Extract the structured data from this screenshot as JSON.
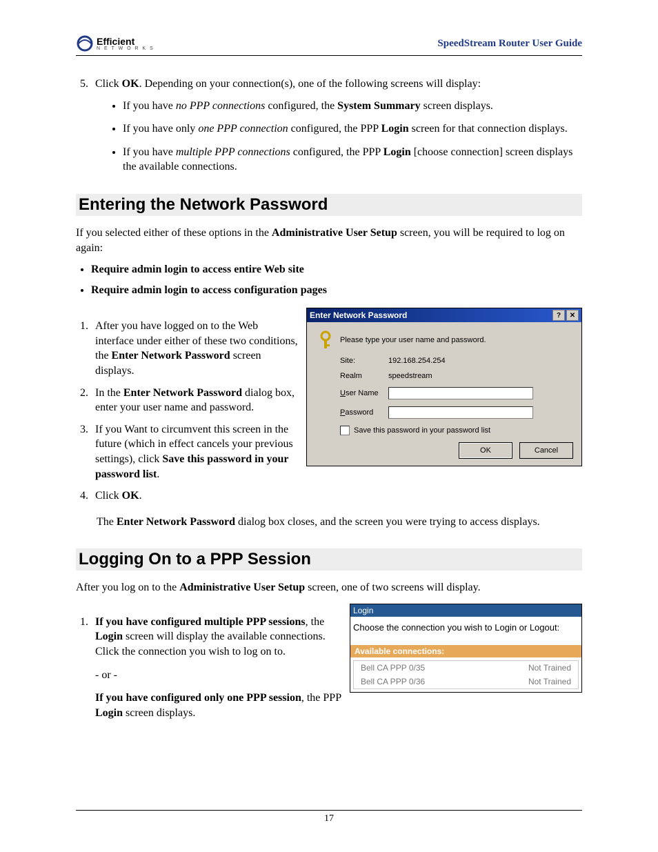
{
  "header": {
    "logo_main": "Efficient",
    "logo_sub": "N E T W O R K S",
    "guide_title": "SpeedStream Router User Guide"
  },
  "top": {
    "step5_num": "5.",
    "step5a": "Click ",
    "step5b": "OK",
    "step5c": ". Depending on your connection(s), one of the following screens will display:",
    "b1a": "If you have ",
    "b1b": "no PPP connections",
    "b1c": " configured, the ",
    "b1d": "System Summary",
    "b1e": " screen displays.",
    "b2a": "If you have only ",
    "b2b": "one PPP connection",
    "b2c": " configured, the PPP ",
    "b2d": "Login",
    "b2e": " screen for that connection displays.",
    "b3a": "If you have ",
    "b3b": "multiple PPP connections",
    "b3c": " configured, the PPP ",
    "b3d": "Login",
    "b3e": " [choose connection] screen displays the available connections."
  },
  "sec1": {
    "heading": "Entering the Network Password",
    "intro_a": "If you selected either of these options in the ",
    "intro_b": "Administrative User Setup",
    "intro_c": " screen, you will be required to log on again:",
    "opt1": "Require admin login to access entire Web site",
    "opt2": "Require admin login to access configuration pages",
    "s1a": "After you have logged on to the Web interface under either of these two conditions, the ",
    "s1b": "Enter Network Password",
    "s1c": " screen displays.",
    "s2a": "In the ",
    "s2b": "Enter Network Password",
    "s2c": " dialog box, enter your user name and password.",
    "s3a": "If you Want to circumvent this screen in the future (which in effect cancels your previous settings), click ",
    "s3b": "Save this password in your password list",
    "s3c": ".",
    "s4a": "Click ",
    "s4b": "OK",
    "s4c": ".",
    "after_a": "The ",
    "after_b": "Enter Network Password",
    "after_c": " dialog box closes, and the screen you were trying to access displays."
  },
  "dlg": {
    "title": "Enter Network Password",
    "help": "?",
    "close": "✕",
    "prompt": "Please type your user name and password.",
    "site_lbl": "Site:",
    "site_val": "192.168.254.254",
    "realm_lbl": "Realm",
    "realm_val": "speedstream",
    "user_u": "U",
    "user_rest": "ser Name",
    "pass_u": "P",
    "pass_rest": "assword",
    "save_u": "S",
    "save_rest": "ave this password in your password list",
    "ok": "OK",
    "cancel": "Cancel"
  },
  "sec2": {
    "heading": "Logging On to a PPP Session",
    "intro_a": "After you log on to the ",
    "intro_b": "Administrative User Setup",
    "intro_c": " screen, one of two screens will display.",
    "s1a": "If you have configured multiple PPP sessions",
    "s1b": ", the ",
    "s1c": "Login",
    "s1d": " screen will display the available connections. Click the connection you wish to log on to.",
    "or": "- or -",
    "s2a": "If you have configured only one PPP session",
    "s2b": ", the PPP ",
    "s2c": "Login",
    "s2d": " screen displays."
  },
  "login": {
    "title": "Login",
    "msg": "Choose the connection you wish to Login or Logout:",
    "avail": "Available connections:",
    "rows": [
      {
        "name": "Bell CA PPP 0/35",
        "status": "Not Trained"
      },
      {
        "name": "Bell CA PPP 0/36",
        "status": "Not Trained"
      }
    ]
  },
  "footer": {
    "page": "17"
  }
}
